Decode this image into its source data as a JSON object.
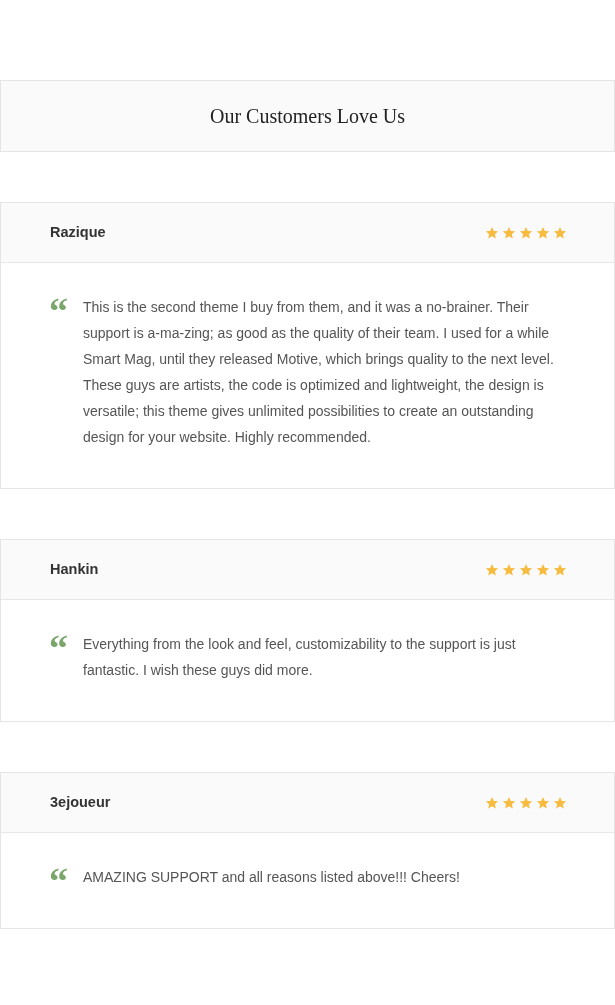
{
  "section": {
    "title": "Our Customers Love Us"
  },
  "reviews": [
    {
      "name": "Razique",
      "stars": 5,
      "quote_mark": "“",
      "text": "This is the second theme I buy from them, and it was a no-brainer. Their support is a-ma-zing; as good as the quality of their team. I used for a while Smart Mag, until they released Motive, which brings quality to the next level. These guys are artists, the code is optimized and lightweight, the design is versatile; this theme gives unlimited possibilities to create an outstanding design for your website. Highly recommended."
    },
    {
      "name": "Hankin",
      "stars": 5,
      "quote_mark": "“",
      "text": "Everything from the look and feel, customizability to the support is just fantastic. I wish these guys did more."
    },
    {
      "name": "3ejoueur",
      "stars": 5,
      "quote_mark": "“",
      "text": "AMAZING SUPPORT and all reasons listed above!!! Cheers!"
    }
  ]
}
